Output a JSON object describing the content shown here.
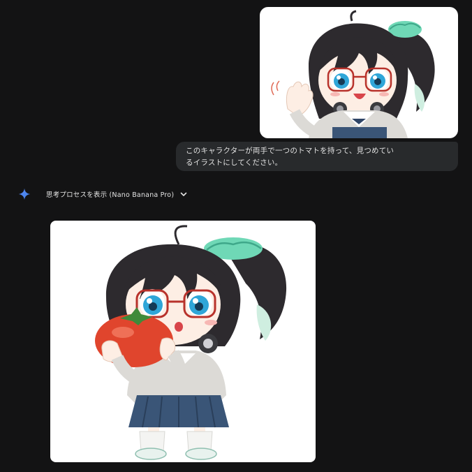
{
  "conversation": {
    "user_message": "このキャラクターが両手で一つのトマトを持って、見つめているイラストにしてください。",
    "user_message_line1": "このキャラクターが両手で一つのトマトを持って、見つめてい",
    "user_message_line2": "るイラストにしてください。",
    "response_toggle_label": "思考プロセスを表示 (Nano Banana Pro)"
  },
  "icons": {
    "assistant": "sparkle-icon",
    "toggle": "chevron-down-icon"
  },
  "colors": {
    "background": "#131314",
    "bubble": "#282a2c",
    "text": "#e3e3e3",
    "sparkle": "#4a90f2",
    "hair": "#2d2a2e",
    "scrunchie": "#6fd8b6",
    "eyes": "#2fa6d8",
    "tomato": "#e0452d",
    "skirt": "#3a5577",
    "cardigan": "#dcdad6"
  }
}
